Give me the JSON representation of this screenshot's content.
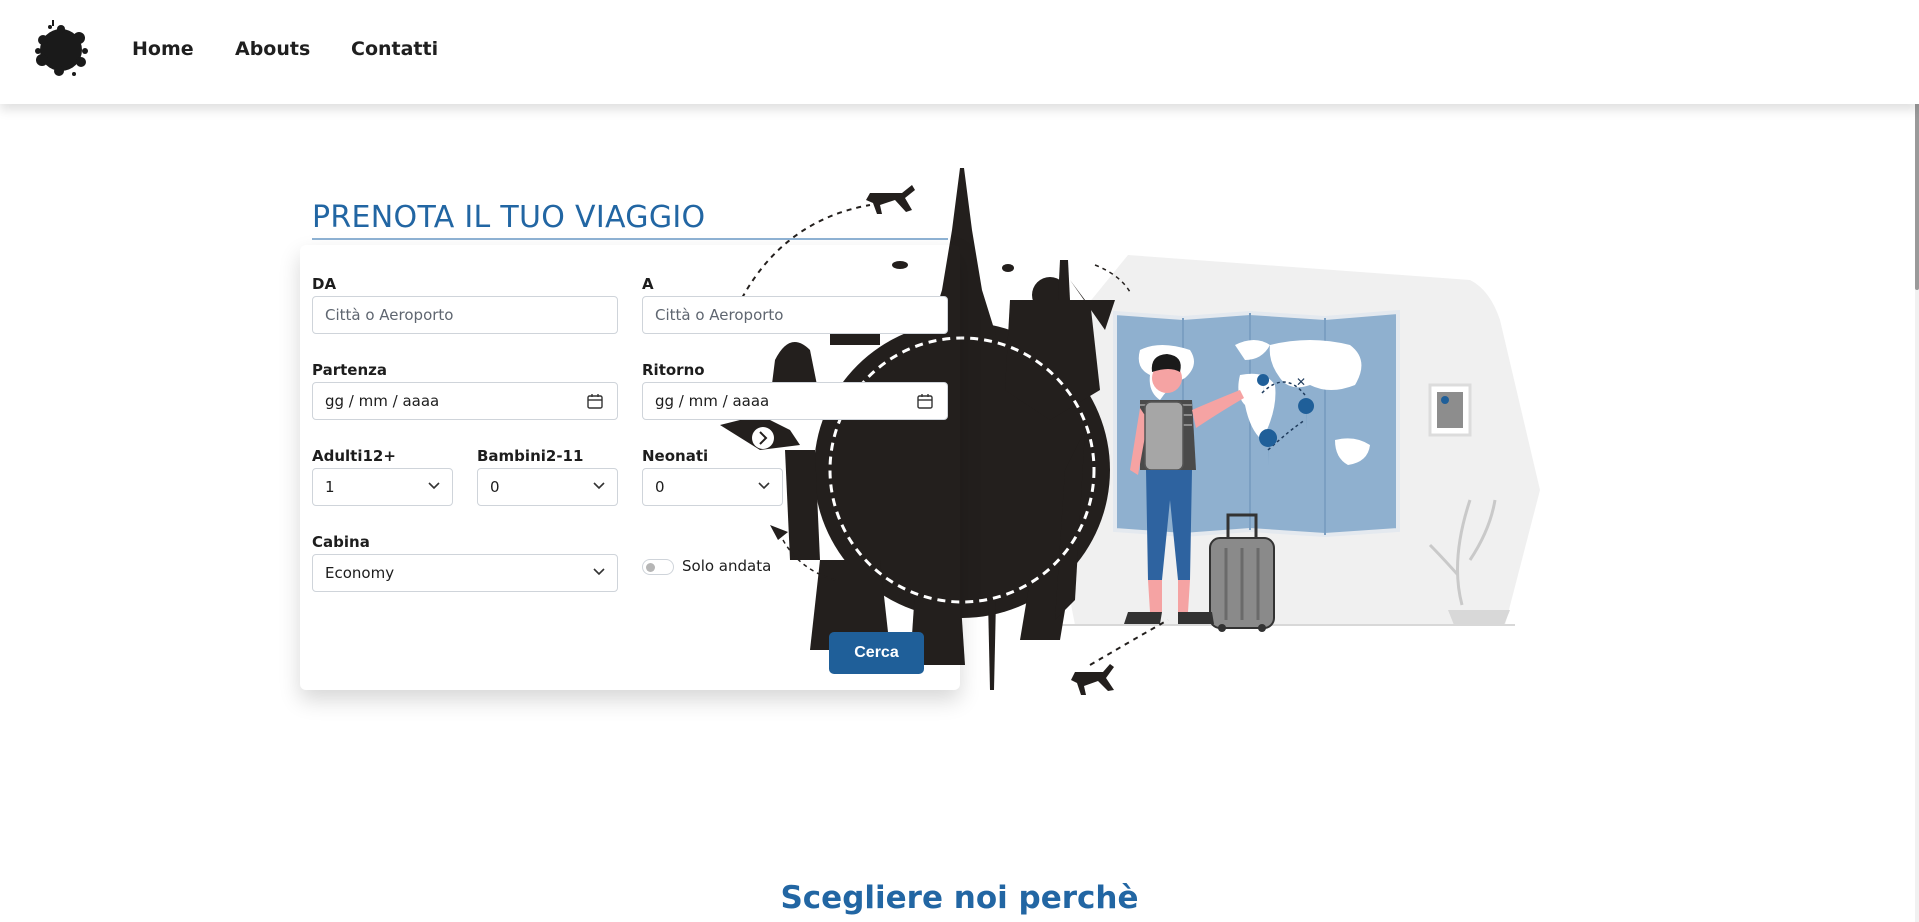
{
  "nav": {
    "links": [
      "Home",
      "Abouts",
      "Contatti"
    ]
  },
  "hero": {
    "title": "PRENOTA IL TUO VIAGGIO"
  },
  "form": {
    "from_label": "DA",
    "from_placeholder": "Città o Aeroporto",
    "to_label": "A",
    "to_placeholder": "Città o Aeroporto",
    "departure_label": "Partenza",
    "departure_placeholder": "gg / mm / aaaa",
    "return_label": "Ritorno",
    "return_placeholder": "gg / mm / aaaa",
    "adults_label": "Adulti12+",
    "adults_value": "1",
    "children_label": "Bambini2-11",
    "children_value": "0",
    "infants_label": "Neonati",
    "infants_value": "0",
    "cabin_label": "Cabina",
    "cabin_value": "Economy",
    "one_way_label": "Solo andata",
    "submit_label": "Cerca"
  },
  "section": {
    "title": "Scegliere noi perchè"
  },
  "colors": {
    "accent": "#2266a3",
    "button": "#1f5f99",
    "silhouette": "#231f1d",
    "map": "#8fb0cf"
  }
}
